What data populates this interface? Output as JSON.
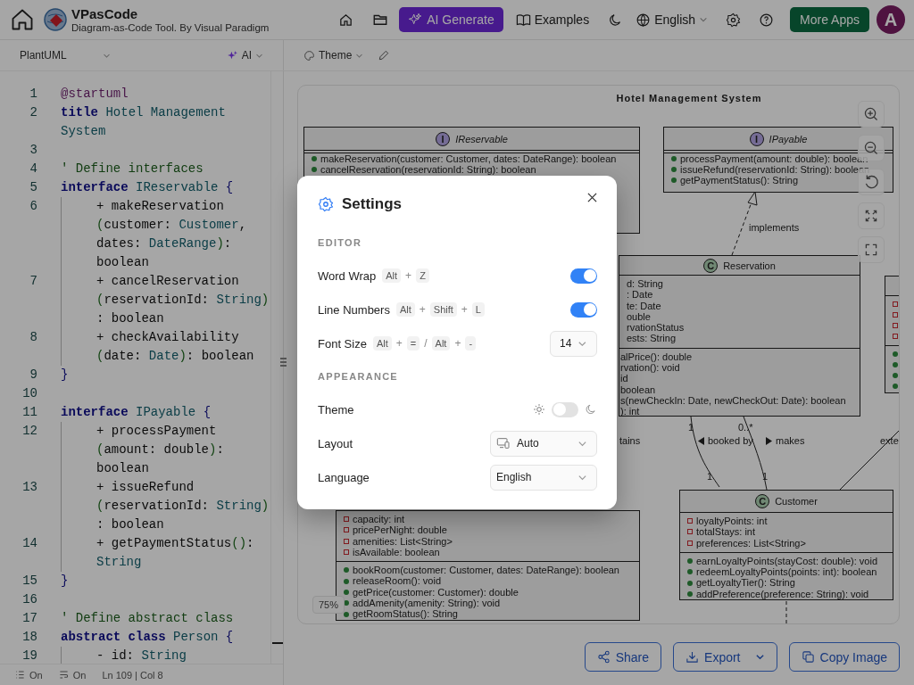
{
  "header": {
    "title": "VPasCode",
    "subtitle": "Diagram-as-Code Tool. By Visual Paradigm",
    "ai_button": "AI Generate",
    "examples": "Examples",
    "language": "English",
    "more_apps": "More Apps",
    "avatar": "A"
  },
  "toolbar": {
    "language": "PlantUML",
    "ai": "AI",
    "theme": "Theme"
  },
  "editor": {
    "lines": [
      {
        "number": "1",
        "rows": [
          {
            "segments": [
              {
                "text": "@startuml",
                "kind": "tag"
              }
            ]
          }
        ]
      },
      {
        "number": "2",
        "rows": [
          {
            "segments": [
              {
                "text": "title ",
                "kind": "kw"
              },
              {
                "text": "Hotel Management",
                "kind": "str"
              }
            ]
          },
          {
            "segments": [
              {
                "text": "System",
                "kind": "str"
              }
            ]
          }
        ]
      },
      {
        "number": "3"
      },
      {
        "number": "4",
        "rows": [
          {
            "segments": [
              {
                "text": "' Define interfaces",
                "kind": "comment"
              }
            ]
          }
        ]
      },
      {
        "number": "5",
        "rows": [
          {
            "segments": [
              {
                "text": "interface ",
                "kind": "kw"
              },
              {
                "text": "IReservable ",
                "kind": "type"
              },
              {
                "text": "{",
                "kind": "brace"
              }
            ]
          }
        ]
      },
      {
        "number": "6",
        "indented": true,
        "rows": [
          {
            "segments": [
              {
                "text": "+ makeReservation",
                "kind": "plain"
              }
            ]
          },
          {
            "segments": [
              {
                "text": "(",
                "kind": "paren"
              },
              {
                "text": "customer: ",
                "kind": "plain"
              },
              {
                "text": "Customer",
                "kind": "type"
              },
              {
                "text": ",",
                "kind": "plain"
              }
            ]
          },
          {
            "segments": [
              {
                "text": "dates: ",
                "kind": "plain"
              },
              {
                "text": "DateRange",
                "kind": "type"
              },
              {
                "text": ")",
                "kind": "paren"
              },
              {
                "text": ":",
                "kind": "plain"
              }
            ]
          },
          {
            "segments": [
              {
                "text": "boolean",
                "kind": "plain"
              }
            ]
          }
        ]
      },
      {
        "number": "7",
        "indented": true,
        "rows": [
          {
            "segments": [
              {
                "text": "+ cancelReservation",
                "kind": "plain"
              }
            ]
          },
          {
            "segments": [
              {
                "text": "(",
                "kind": "paren"
              },
              {
                "text": "reservationId: ",
                "kind": "plain"
              },
              {
                "text": "String",
                "kind": "type"
              },
              {
                "text": ")",
                "kind": "paren"
              }
            ]
          },
          {
            "segments": [
              {
                "text": ": boolean",
                "kind": "plain"
              }
            ]
          }
        ]
      },
      {
        "number": "8",
        "indented": true,
        "rows": [
          {
            "segments": [
              {
                "text": "+ checkAvailability",
                "kind": "plain"
              }
            ]
          },
          {
            "segments": [
              {
                "text": "(",
                "kind": "paren"
              },
              {
                "text": "date: ",
                "kind": "plain"
              },
              {
                "text": "Date",
                "kind": "type"
              },
              {
                "text": ")",
                "kind": "paren"
              },
              {
                "text": ": boolean",
                "kind": "plain"
              }
            ]
          }
        ]
      },
      {
        "number": "9",
        "rows": [
          {
            "segments": [
              {
                "text": "}",
                "kind": "brace"
              }
            ]
          }
        ]
      },
      {
        "number": "10"
      },
      {
        "number": "11",
        "rows": [
          {
            "segments": [
              {
                "text": "interface ",
                "kind": "kw"
              },
              {
                "text": "IPayable ",
                "kind": "type"
              },
              {
                "text": "{",
                "kind": "brace"
              }
            ]
          }
        ]
      },
      {
        "number": "12",
        "indented": true,
        "rows": [
          {
            "segments": [
              {
                "text": "+ processPayment",
                "kind": "plain"
              }
            ]
          },
          {
            "segments": [
              {
                "text": "(",
                "kind": "paren"
              },
              {
                "text": "amount: double",
                "kind": "plain"
              },
              {
                "text": ")",
                "kind": "paren"
              },
              {
                "text": ":",
                "kind": "plain"
              }
            ]
          },
          {
            "segments": [
              {
                "text": "boolean",
                "kind": "plain"
              }
            ]
          }
        ]
      },
      {
        "number": "13",
        "indented": true,
        "rows": [
          {
            "segments": [
              {
                "text": "+ issueRefund",
                "kind": "plain"
              }
            ]
          },
          {
            "segments": [
              {
                "text": "(",
                "kind": "paren"
              },
              {
                "text": "reservationId: ",
                "kind": "plain"
              },
              {
                "text": "String",
                "kind": "type"
              },
              {
                "text": ")",
                "kind": "paren"
              }
            ]
          },
          {
            "segments": [
              {
                "text": ": boolean",
                "kind": "plain"
              }
            ]
          }
        ]
      },
      {
        "number": "14",
        "indented": true,
        "rows": [
          {
            "segments": [
              {
                "text": "+ getPaymentStatus",
                "kind": "plain"
              },
              {
                "text": "()",
                "kind": "paren"
              },
              {
                "text": ":",
                "kind": "plain"
              }
            ]
          },
          {
            "segments": [
              {
                "text": "String",
                "kind": "type"
              }
            ]
          }
        ]
      },
      {
        "number": "15",
        "rows": [
          {
            "segments": [
              {
                "text": "}",
                "kind": "brace"
              }
            ]
          }
        ]
      },
      {
        "number": "16"
      },
      {
        "number": "17",
        "rows": [
          {
            "segments": [
              {
                "text": "' Define abstract class",
                "kind": "comment"
              }
            ]
          }
        ]
      },
      {
        "number": "18",
        "rows": [
          {
            "segments": [
              {
                "text": "abstract class ",
                "kind": "kw"
              },
              {
                "text": "Person ",
                "kind": "type"
              },
              {
                "text": "{",
                "kind": "brace"
              }
            ]
          }
        ]
      },
      {
        "number": "19",
        "indented": true,
        "rows": [
          {
            "segments": [
              {
                "text": "- id: ",
                "kind": "plain"
              },
              {
                "text": "String",
                "kind": "type"
              }
            ]
          }
        ]
      }
    ]
  },
  "status_bar": {
    "line_numbers": "On",
    "word_wrap": "On",
    "position": "Ln 109 | Col 8"
  },
  "diagram": {
    "title": "Hotel Management System",
    "zoom": "75%",
    "classes": [
      {
        "kind": "interface",
        "badge": "I",
        "name": "IReservable",
        "markers": true,
        "methods": [
          "makeReservation(customer: Customer, dates: DateRange): boolean",
          "cancelReservation(reservationId: String): boolean"
        ]
      },
      {
        "kind": "interface",
        "badge": "I",
        "name": "IPayable",
        "markers": true,
        "methods": [
          "processPayment(amount: double): boolean",
          "issueRefund(reservationId: String): boolean",
          "getPaymentStatus(): String"
        ]
      },
      {
        "kind": "class",
        "badge": "C",
        "name": "Reservation",
        "markers": false,
        "attributes": [
          "d: String",
          ": Date",
          "te: Date",
          "ouble",
          "rvationStatus",
          "ests: String"
        ],
        "methods": [
          "alPrice(): double",
          "rvation(): void",
          "id",
          "boolean",
          "s(newCheckIn: Date, newCheckOut: Date): boolean",
          "): int"
        ]
      },
      {
        "kind": "stub"
      },
      {
        "kind": "class",
        "badge": "C",
        "name": "Customer",
        "markers": true,
        "attributes": [
          "loyaltyPoints: int",
          "totalStays: int",
          "preferences: List<String>"
        ],
        "methods": [
          "earnLoyaltyPoints(stayCost: double): void",
          "redeemLoyaltyPoints(points: int): boolean",
          "getLoyaltyTier(): String",
          "addPreference(preference: String): void"
        ]
      },
      {
        "kind": "class",
        "markers": true,
        "attributes": [
          "capacity: int",
          "pricePerNight: double",
          "amenities: List<String>",
          "isAvailable: boolean"
        ],
        "methods": [
          "bookRoom(customer: Customer, dates: DateRange): boolean",
          "releaseRoom(): void",
          "getPrice(customer: Customer): double",
          "addAmenity(amenity: String): void",
          "getRoomStatus(): String"
        ]
      }
    ],
    "labels": [
      {
        "text": "implements",
        "kind": "plain"
      },
      {
        "text": "1",
        "kind": "plain"
      },
      {
        "text": "0..*",
        "kind": "plain"
      },
      {
        "text": "booked by",
        "kind": "left"
      },
      {
        "text": "makes",
        "kind": "right"
      },
      {
        "text": "1",
        "kind": "plain"
      },
      {
        "text": "1",
        "kind": "plain"
      },
      {
        "text": "tains",
        "kind": "plain"
      },
      {
        "text": "exte",
        "kind": "plain"
      }
    ]
  },
  "actions": [
    {
      "label": "Share",
      "kind": "share"
    },
    {
      "label": "Export",
      "kind": "export"
    },
    {
      "label": "Copy Image",
      "kind": "copy"
    }
  ],
  "settings": {
    "title": "Settings",
    "sections": [
      {
        "heading": "EDITOR",
        "rows": [
          {
            "kind": "toggle",
            "label": "Word Wrap",
            "shortcut": [
              {
                "text": "Alt",
                "kind": "key"
              },
              {
                "text": "+",
                "kind": "sep"
              },
              {
                "text": "Z",
                "kind": "key"
              }
            ],
            "on": true
          },
          {
            "kind": "toggle",
            "label": "Line Numbers",
            "shortcut": [
              {
                "text": "Alt",
                "kind": "key"
              },
              {
                "text": "+",
                "kind": "sep"
              },
              {
                "text": "Shift",
                "kind": "key"
              },
              {
                "text": "+",
                "kind": "sep"
              },
              {
                "text": "L",
                "kind": "key"
              }
            ],
            "on": true
          },
          {
            "kind": "select",
            "label": "Font Size",
            "shortcut": [
              {
                "text": "Alt",
                "kind": "key"
              },
              {
                "text": "+",
                "kind": "sep"
              },
              {
                "text": "=",
                "kind": "key"
              },
              {
                "text": "/",
                "kind": "sep"
              },
              {
                "text": "Alt",
                "kind": "key"
              },
              {
                "text": "+",
                "kind": "sep"
              },
              {
                "text": "-",
                "kind": "key"
              }
            ],
            "value": "14"
          }
        ]
      },
      {
        "heading": "APPEARANCE",
        "rows": [
          {
            "kind": "theme",
            "label": "Theme",
            "on": false
          },
          {
            "kind": "device_select",
            "label": "Layout",
            "value": "Auto"
          },
          {
            "kind": "select",
            "label": "Language",
            "value": "English"
          }
        ]
      }
    ]
  }
}
